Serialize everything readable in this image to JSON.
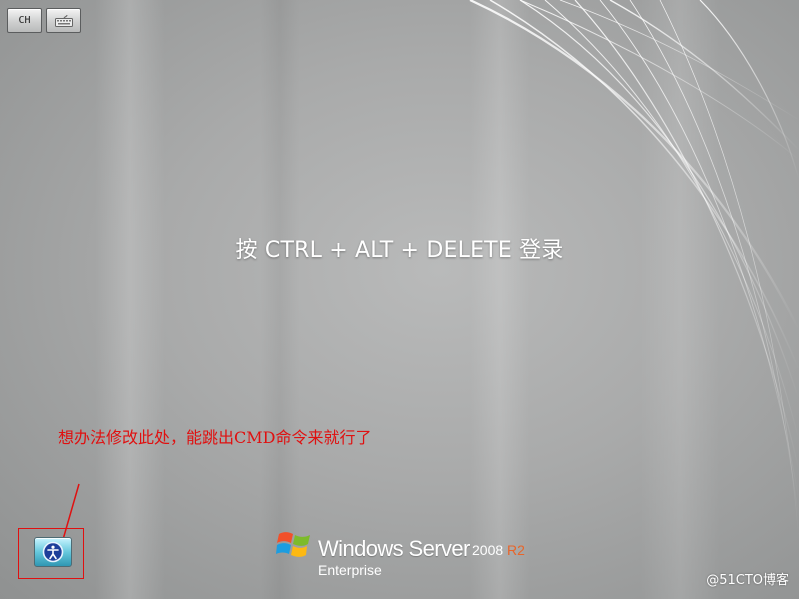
{
  "toolbar": {
    "language_label": "CH",
    "keyboard_icon": "keyboard-icon"
  },
  "login": {
    "prompt": "按 CTRL + ALT + DELETE 登录"
  },
  "annotation": {
    "text": "想办法修改此处，能跳出CMD命令来就行了",
    "color": "#e01010"
  },
  "ease_of_access": {
    "icon": "ease-of-access-icon"
  },
  "brand": {
    "product": "Windows Server",
    "version": "2008",
    "release": "R2",
    "edition": "Enterprise",
    "release_color": "#e8652a"
  },
  "watermark": {
    "text": "@51CTO博客"
  }
}
